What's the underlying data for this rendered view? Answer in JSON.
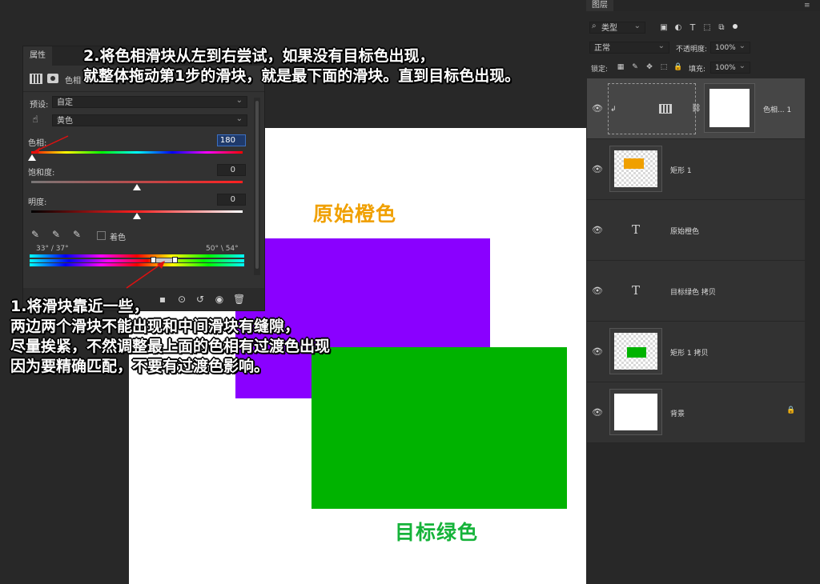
{
  "canvas": {
    "orig_label": "原始橙色",
    "target_label": "目标绿色",
    "colors": {
      "purple": "#8a00ff",
      "green": "#00b300",
      "orange": "#f0a000",
      "green_text": "#16b33a"
    }
  },
  "properties": {
    "tab": "属性",
    "header_label": "色相",
    "preset_label": "预设:",
    "preset_value": "自定",
    "channel_value": "黄色",
    "hue_label": "色相:",
    "hue_value": "180",
    "saturation_label": "饱和度:",
    "saturation_value": "0",
    "lightness_label": "明度:",
    "lightness_value": "0",
    "colorize_label": "着色",
    "range_left": "33° / 37°",
    "range_right": "50° \\ 54°"
  },
  "annotations": {
    "step2_line1": "2.将色相滑块从左到右尝试，如果没有目标色出现，",
    "step2_line2": "就整体拖动第1步的滑块，就是最下面的滑块。直到目标色出现。",
    "step1_line1": "1.将滑块靠近一些，",
    "step1_line2": "两边两个滑块不能出现和中间滑块有缝隙，",
    "step1_line3": "尽量挨紧，不然调整最上面的色相有过渡色出现",
    "step1_line4": "因为要精确匹配，不要有过渡色影响。"
  },
  "layers": {
    "tab": "图层",
    "filter_kind": "类型",
    "blend_mode": "正常",
    "opacity_label": "不透明度:",
    "opacity_value": "100%",
    "lock_label": "锁定:",
    "fill_label": "填充:",
    "fill_value": "100%",
    "items": [
      {
        "name": "色相... 1",
        "type": "adjustment"
      },
      {
        "name": "矩形 1",
        "type": "shape"
      },
      {
        "name": "原始橙色",
        "type": "text"
      },
      {
        "name": "目标绿色 拷贝",
        "type": "text"
      },
      {
        "name": "矩形 1 拷贝",
        "type": "shape"
      },
      {
        "name": "背景",
        "type": "background"
      }
    ]
  }
}
